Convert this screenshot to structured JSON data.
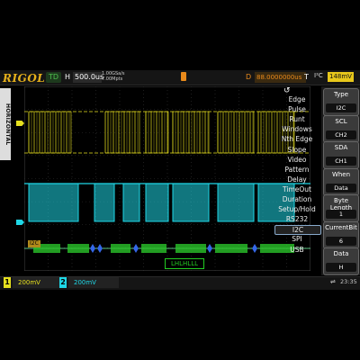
{
  "brand": {
    "logo": "RIGOL"
  },
  "status": {
    "run_state": "TD",
    "h_label": "H",
    "timebase": "500.0us",
    "sample_rate_line1": "1.00GSa/s",
    "sample_rate_line2": "7.00Mpts",
    "d_label": "D",
    "delay": "88.0000000us",
    "t_label": "T",
    "trigger_type": "I²C",
    "trigger_level": "148mV"
  },
  "horizontal_tab": "HORIZONTAL",
  "menu": {
    "icon": "menu-return-icon",
    "items": [
      "Edge",
      "Pulse",
      "Runt",
      "Windows",
      "Nth Edge",
      "Slope",
      "Video",
      "Pattern",
      "Delay",
      "TimeOut",
      "Duration",
      "Setup/Hold",
      "RS232",
      "I2C",
      "SPI",
      "USB"
    ],
    "selected": "I2C"
  },
  "softkeys": [
    {
      "label": "Type",
      "value": "I2C"
    },
    {
      "label": "SCL",
      "value": "CH2"
    },
    {
      "label": "SDA",
      "value": "CH1"
    },
    {
      "label": "When",
      "value": "Data"
    },
    {
      "label": "Byte Length",
      "value": "1"
    },
    {
      "label": "CurrentBit",
      "value": "6"
    },
    {
      "label": "Data",
      "value": "H"
    }
  ],
  "decode": {
    "tag": "I2C",
    "popup": "LHLHLLL"
  },
  "channels": [
    {
      "num": "1",
      "scale": "200mV",
      "color": "#e6e01f"
    },
    {
      "num": "2",
      "scale": "200mV",
      "color": "#1fd7e6"
    }
  ],
  "clock": "23:35",
  "colors": {
    "ch1": "#e6e01f",
    "ch2": "#1fd7e6",
    "trigger": "#e98a1b",
    "decode": "#2bc42b"
  }
}
